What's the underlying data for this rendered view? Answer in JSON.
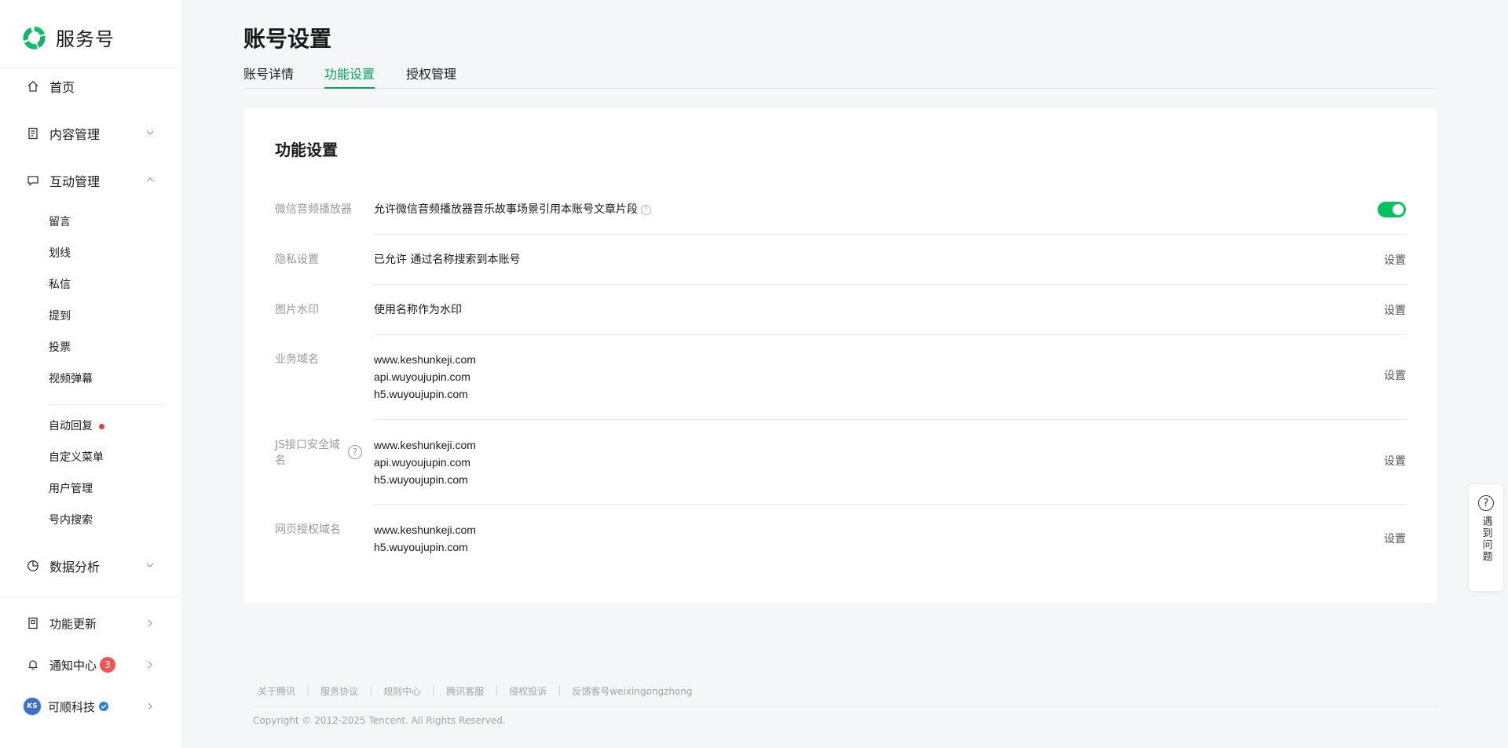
{
  "brand": {
    "name": "服务号",
    "green": "#07c160",
    "accent_green": "#07a35a"
  },
  "sidebar": {
    "home": "首页",
    "content": "内容管理",
    "interaction": "互动管理",
    "interaction_items": [
      "留言",
      "划线",
      "私信",
      "提到",
      "投票",
      "视频弹幕"
    ],
    "service_items": [
      {
        "label": "自动回复",
        "dot": true
      },
      {
        "label": "自定义菜单"
      },
      {
        "label": "用户管理"
      },
      {
        "label": "号内搜索"
      }
    ],
    "analytics": "数据分析",
    "updates": "功能更新",
    "notifications": {
      "label": "通知中心",
      "count": "3"
    },
    "account": {
      "name": "可顺科技",
      "avatar_text": "KS"
    }
  },
  "header": {
    "title": "账号设置",
    "tabs": [
      {
        "label": "账号详情",
        "active": false
      },
      {
        "label": "功能设置",
        "active": true
      },
      {
        "label": "授权管理",
        "active": false
      }
    ]
  },
  "card": {
    "title": "功能设置",
    "rows": [
      {
        "label": "微信音频播放器",
        "value": "允许微信音频播放器音乐故事场景引用本账号文章片段",
        "toggle_on": true
      },
      {
        "label": "隐私设置",
        "value": "已允许 通过名称搜索到本账号",
        "action": "设置"
      },
      {
        "label": "图片水印",
        "value": "使用名称作为水印",
        "action": "设置"
      },
      {
        "label": "业务域名",
        "values": [
          "www.keshunkeji.com",
          "api.wuyoujupin.com",
          "h5.wuyoujupin.com"
        ],
        "action": "设置"
      },
      {
        "label": "JS接口安全域名",
        "values": [
          "www.keshunkeji.com",
          "api.wuyoujupin.com",
          "h5.wuyoujupin.com"
        ],
        "action": "设置"
      },
      {
        "label": "网页授权域名",
        "values": [
          "www.keshunkeji.com",
          "h5.wuyoujupin.com"
        ],
        "action": "设置"
      }
    ]
  },
  "footer": {
    "links": [
      "关于腾讯",
      "服务协议",
      "规则中心",
      "腾讯客服",
      "侵权投诉",
      "反馈客号weixingongzhong"
    ],
    "copyright": "Copyright © 2012-2025 Tencent. All Rights Reserved."
  },
  "help": {
    "label": "遇到问题"
  }
}
